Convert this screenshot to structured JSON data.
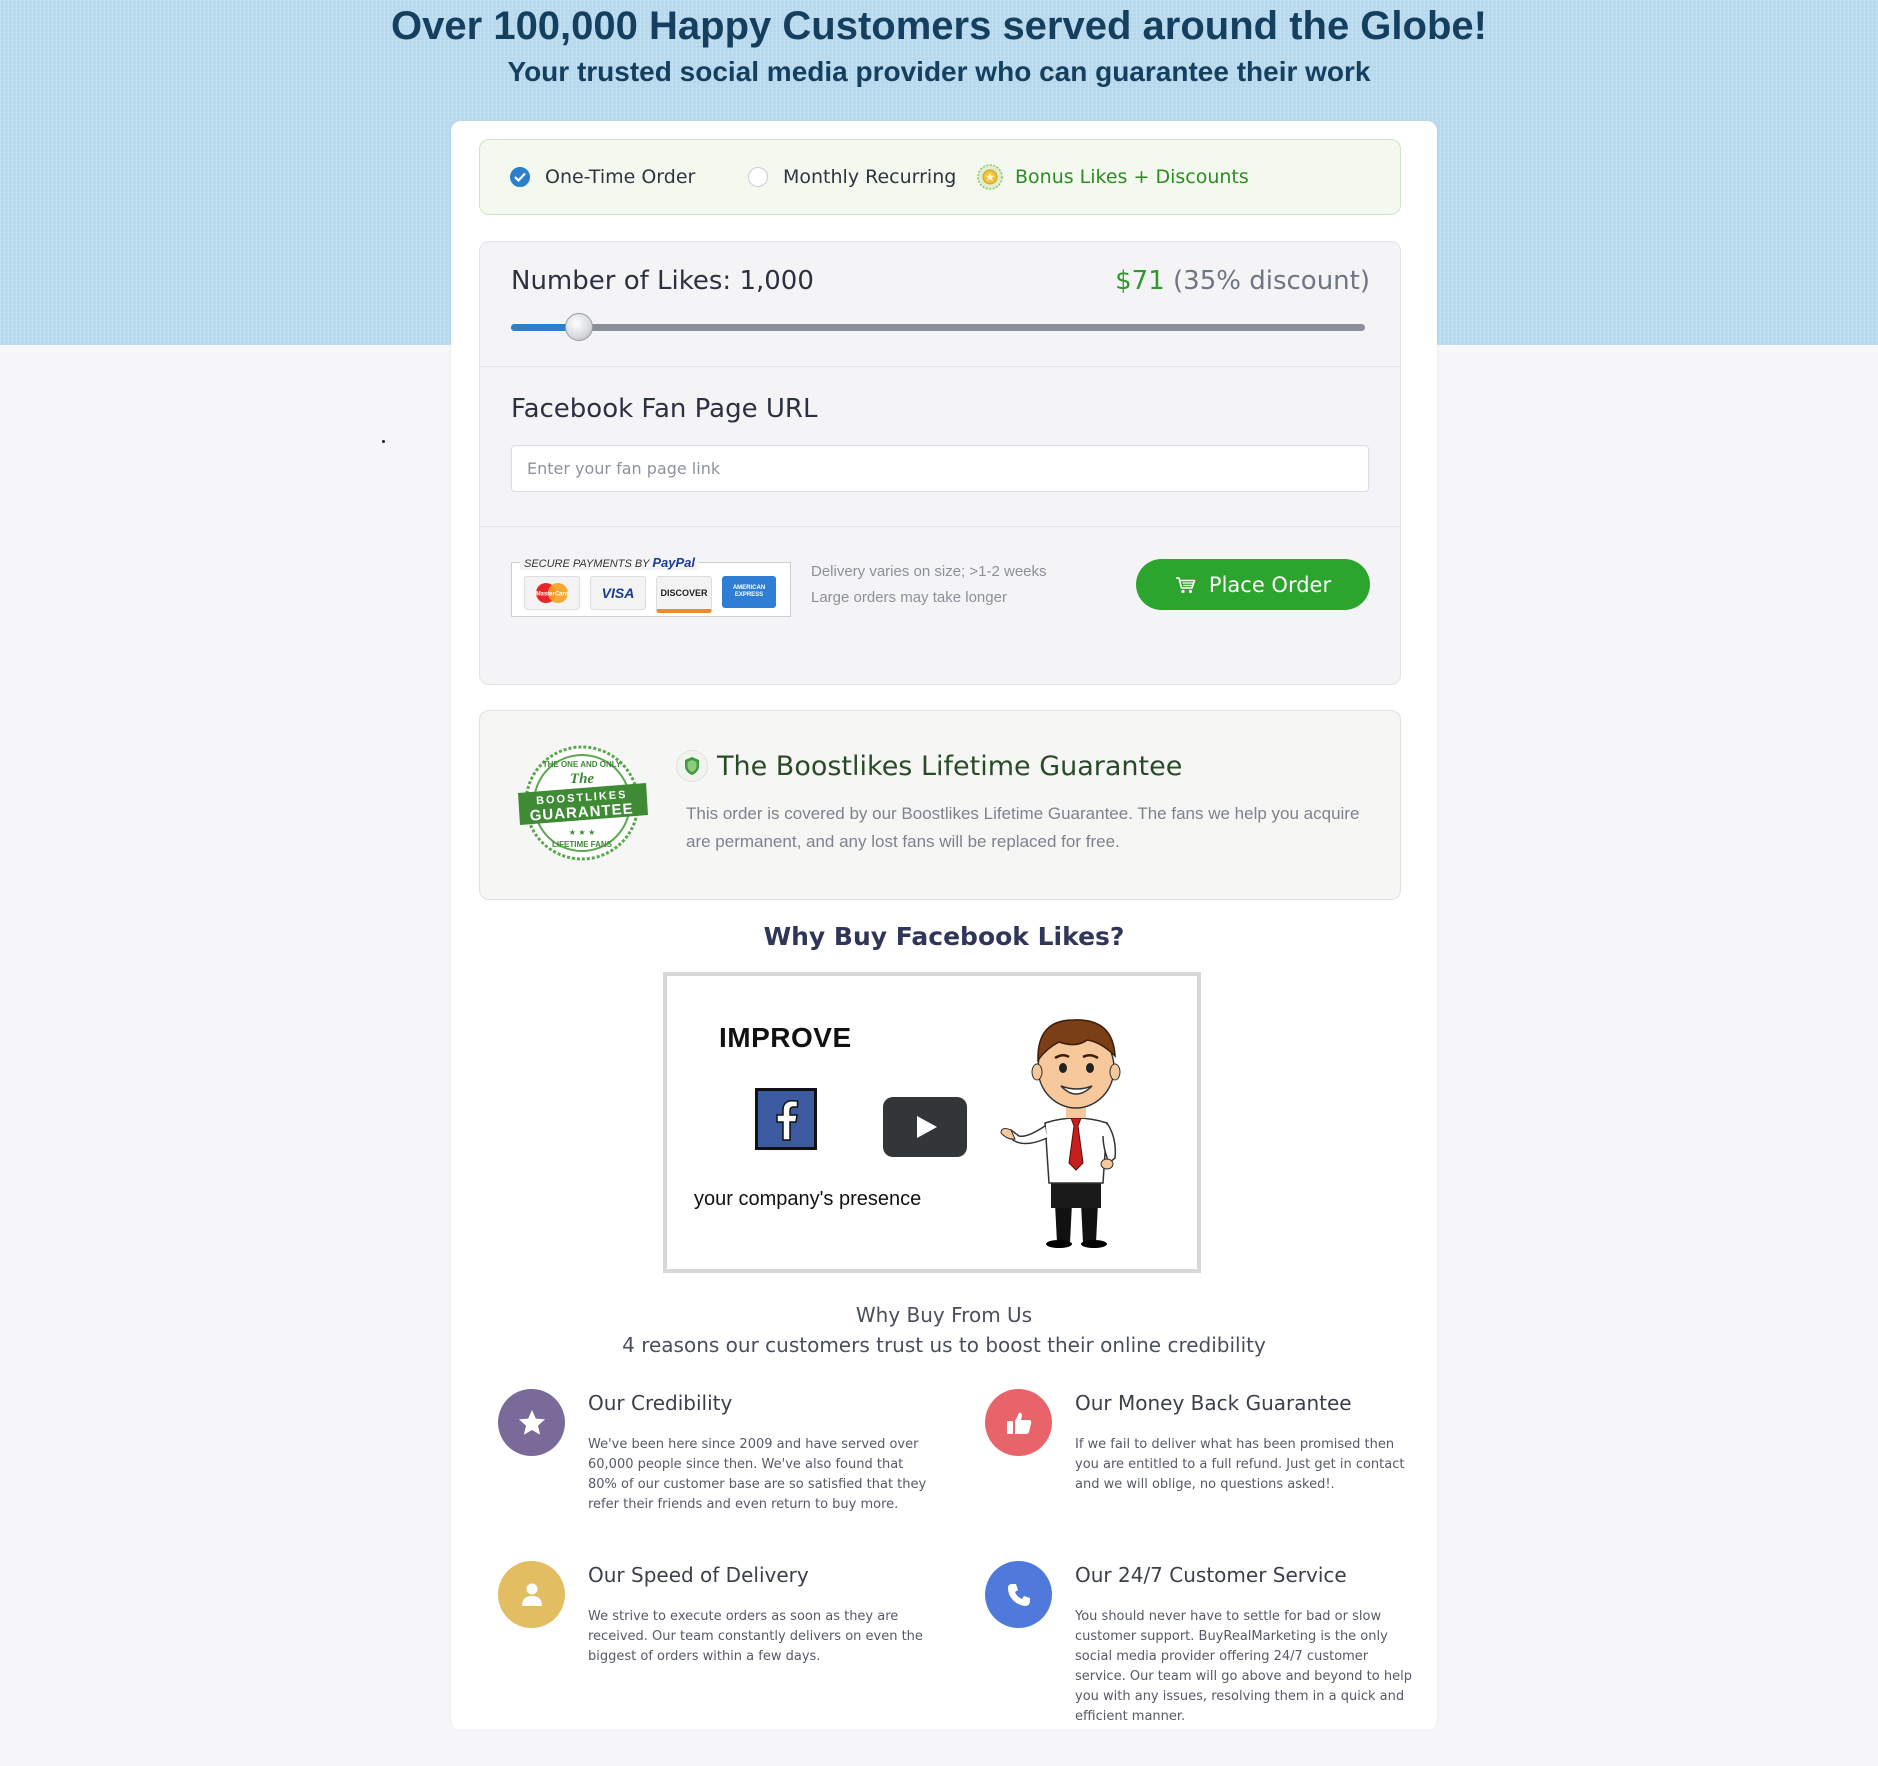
{
  "hero": {
    "title": "Over 100,000 Happy Customers served around the Globe!",
    "subtitle": "Your trusted social media provider who can guarantee their work"
  },
  "order_type": {
    "options": [
      {
        "label": "One-Time Order",
        "selected": true
      },
      {
        "label": "Monthly Recurring",
        "selected": false
      }
    ],
    "bonus_label": "Bonus Likes + Discounts",
    "bonus_icon": "medal-icon"
  },
  "likes": {
    "label": "Number of Likes: 1,000",
    "price": "$71",
    "discount": "(35% discount)",
    "slider_fraction": 0.08,
    "colors": {
      "fill": "#2b7fcb",
      "track": "#8b8f99",
      "price": "#2e9a2a"
    }
  },
  "url": {
    "label": "Facebook Fan Page URL",
    "placeholder": "Enter your fan page link",
    "value": ""
  },
  "payment": {
    "title_prefix": "SECURE PAYMENTS BY",
    "title_brand": "PayPal",
    "cards": [
      "MasterCard",
      "VISA",
      "DISCOVER",
      "AMERICAN EXPRESS"
    ],
    "delivery_line1": "Delivery varies on size; >1-2 weeks",
    "delivery_line2": "Large orders may take longer"
  },
  "place_order": {
    "label": "Place Order",
    "icon": "cart-icon",
    "color": "#2ba52d"
  },
  "guarantee": {
    "seal_top": "THE ONE AND ONLY",
    "seal_the": "The",
    "seal_band1": "BOOSTLIKES",
    "seal_band2": "GUARANTEE",
    "seal_bottom": "LIFETIME FANS",
    "title": "The Boostlikes Lifetime Guarantee",
    "text": "This order is covered by our Boostlikes Lifetime Guarantee. The fans we help you acquire are permanent, and any lost fans will be replaced for free."
  },
  "why_title": "Why Buy Facebook Likes?",
  "video": {
    "headline": "IMPROVE",
    "caption": "your company's presence"
  },
  "why_us": {
    "title": "Why Buy From Us",
    "subtitle": "4 reasons our customers trust us to boost their online credibility",
    "features": [
      {
        "title": "Our Credibility",
        "icon": "star-icon",
        "color": "#7a6a9a",
        "text": "We've been here since 2009 and have served over 60,000 people since then. We've also found that 80% of our customer base are so satisfied that they refer their friends and even return to buy more."
      },
      {
        "title": "Our Money Back Guarantee",
        "icon": "thumbs-up-icon",
        "color": "#e8636a",
        "text": "If we fail to deliver what has been promised then you are entitled to a full refund. Just get in contact and we will oblige, no questions asked!."
      },
      {
        "title": "Our Speed of Delivery",
        "icon": "user-icon",
        "color": "#e3bd62",
        "text": "We strive to execute orders as soon as they are received. Our team constantly delivers on even the biggest of orders within a few days."
      },
      {
        "title": "Our 24/7 Customer Service",
        "icon": "phone-icon",
        "color": "#4f79da",
        "text": "You should never have to settle for bad or slow customer support. BuyRealMarketing is the only social media provider offering 24/7 customer service. Our team will go above and beyond to help you with any issues, resolving them in a quick and efficient manner."
      }
    ]
  }
}
